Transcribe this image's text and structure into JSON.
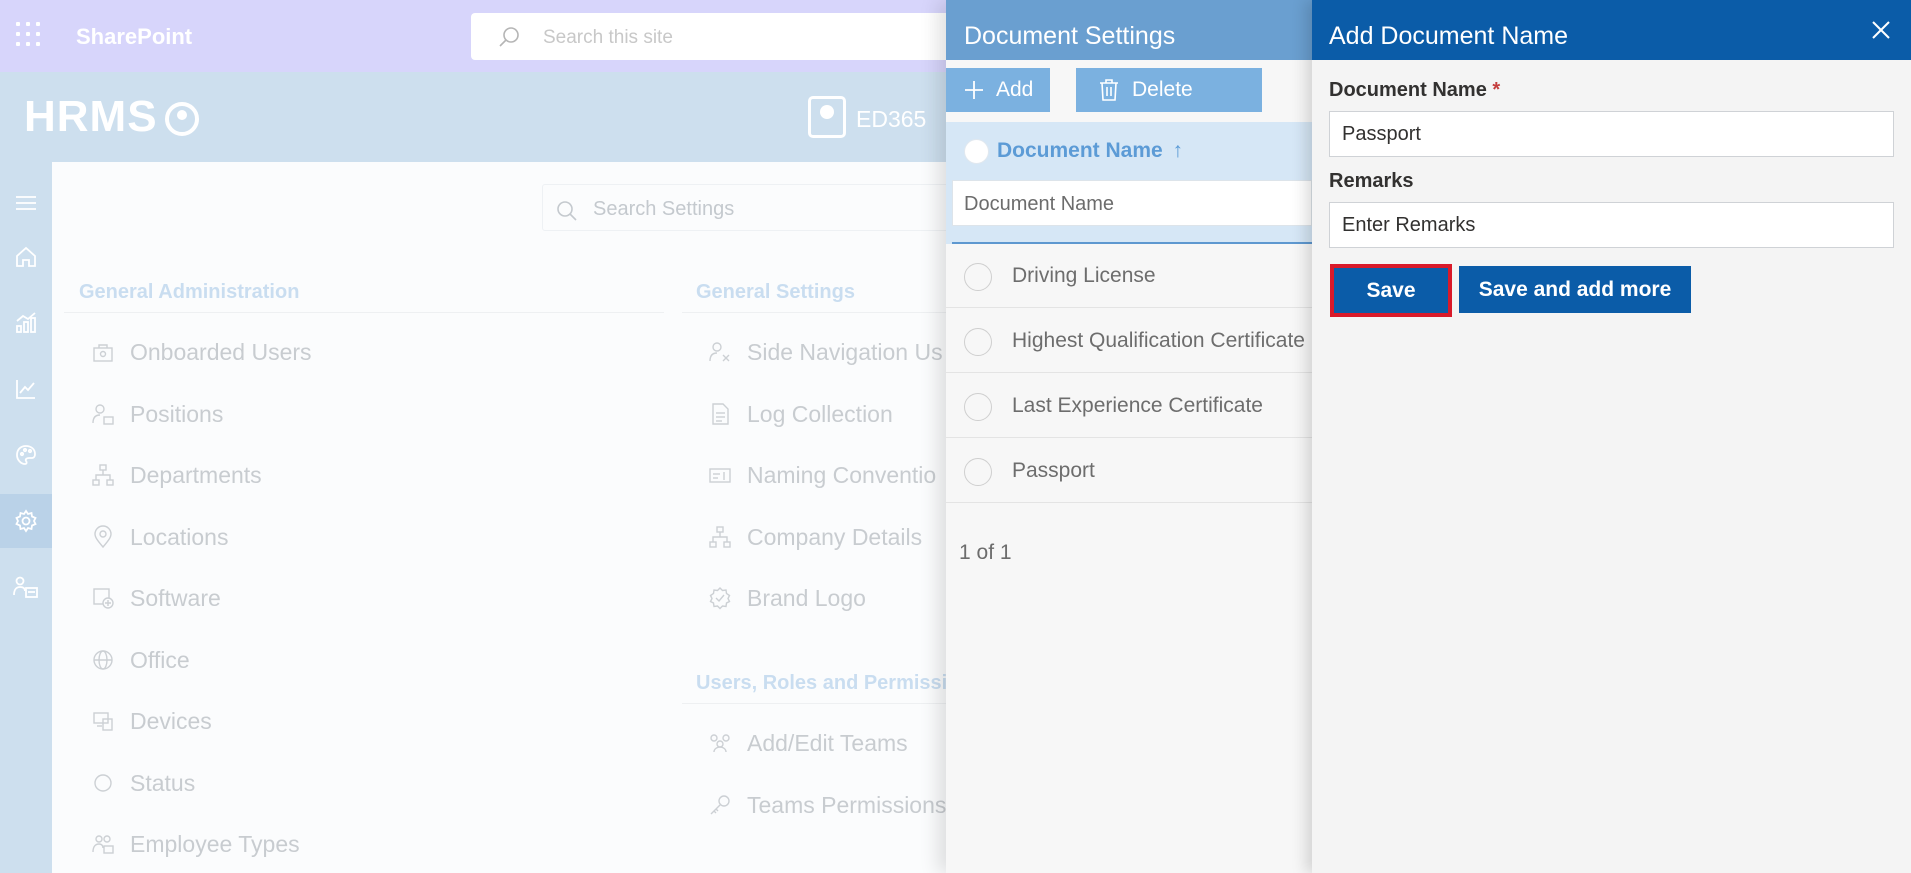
{
  "sharepoint": {
    "title": "SharePoint",
    "search_placeholder": "Search this site"
  },
  "hrms": {
    "logo_text": "HRMS",
    "org_label": "ED365"
  },
  "left_rail": {
    "items": [
      "menu-icon",
      "home-icon",
      "analytics-icon",
      "trend-icon",
      "palette-icon",
      "settings-icon",
      "people-icon"
    ],
    "active": "settings-icon"
  },
  "settings_page": {
    "search_placeholder": "Search Settings",
    "general_administration": {
      "heading": "General Administration",
      "items": [
        "Onboarded Users",
        "Positions",
        "Departments",
        "Locations",
        "Software",
        "Office",
        "Devices",
        "Status",
        "Employee Types"
      ]
    },
    "general_settings": {
      "heading": "General Settings",
      "items": [
        "Side Navigation Us",
        "Log Collection",
        "Naming Conventio",
        "Company Details",
        "Brand Logo"
      ]
    },
    "users_roles": {
      "heading": "Users, Roles and Permissio",
      "items": [
        "Add/Edit Teams",
        "Teams Permissions"
      ]
    }
  },
  "document_settings": {
    "title": "Document Settings",
    "add_label": "Add",
    "delete_label": "Delete",
    "info_glyph": "i",
    "column_header": "Document Name",
    "sort_glyph": "↑",
    "filter_placeholder": "Document Name",
    "rows": [
      "Driving License",
      "Highest Qualification Certificate",
      "Last Experience Certificate",
      "Passport"
    ],
    "pager": "1 of 1"
  },
  "add_document": {
    "title": "Add Document Name",
    "name_label": "Document Name",
    "required_mark": "*",
    "name_value": "Passport",
    "remarks_label": "Remarks",
    "remarks_placeholder": "Enter Remarks",
    "save_label": "Save",
    "save_more_label": "Save and add more"
  },
  "colors": {
    "primary": "#0b5ca8",
    "highlight_border": "#d91a2a",
    "doc_header": "#6a9fd0",
    "sharepoint_bar": "#d7d5fb"
  }
}
